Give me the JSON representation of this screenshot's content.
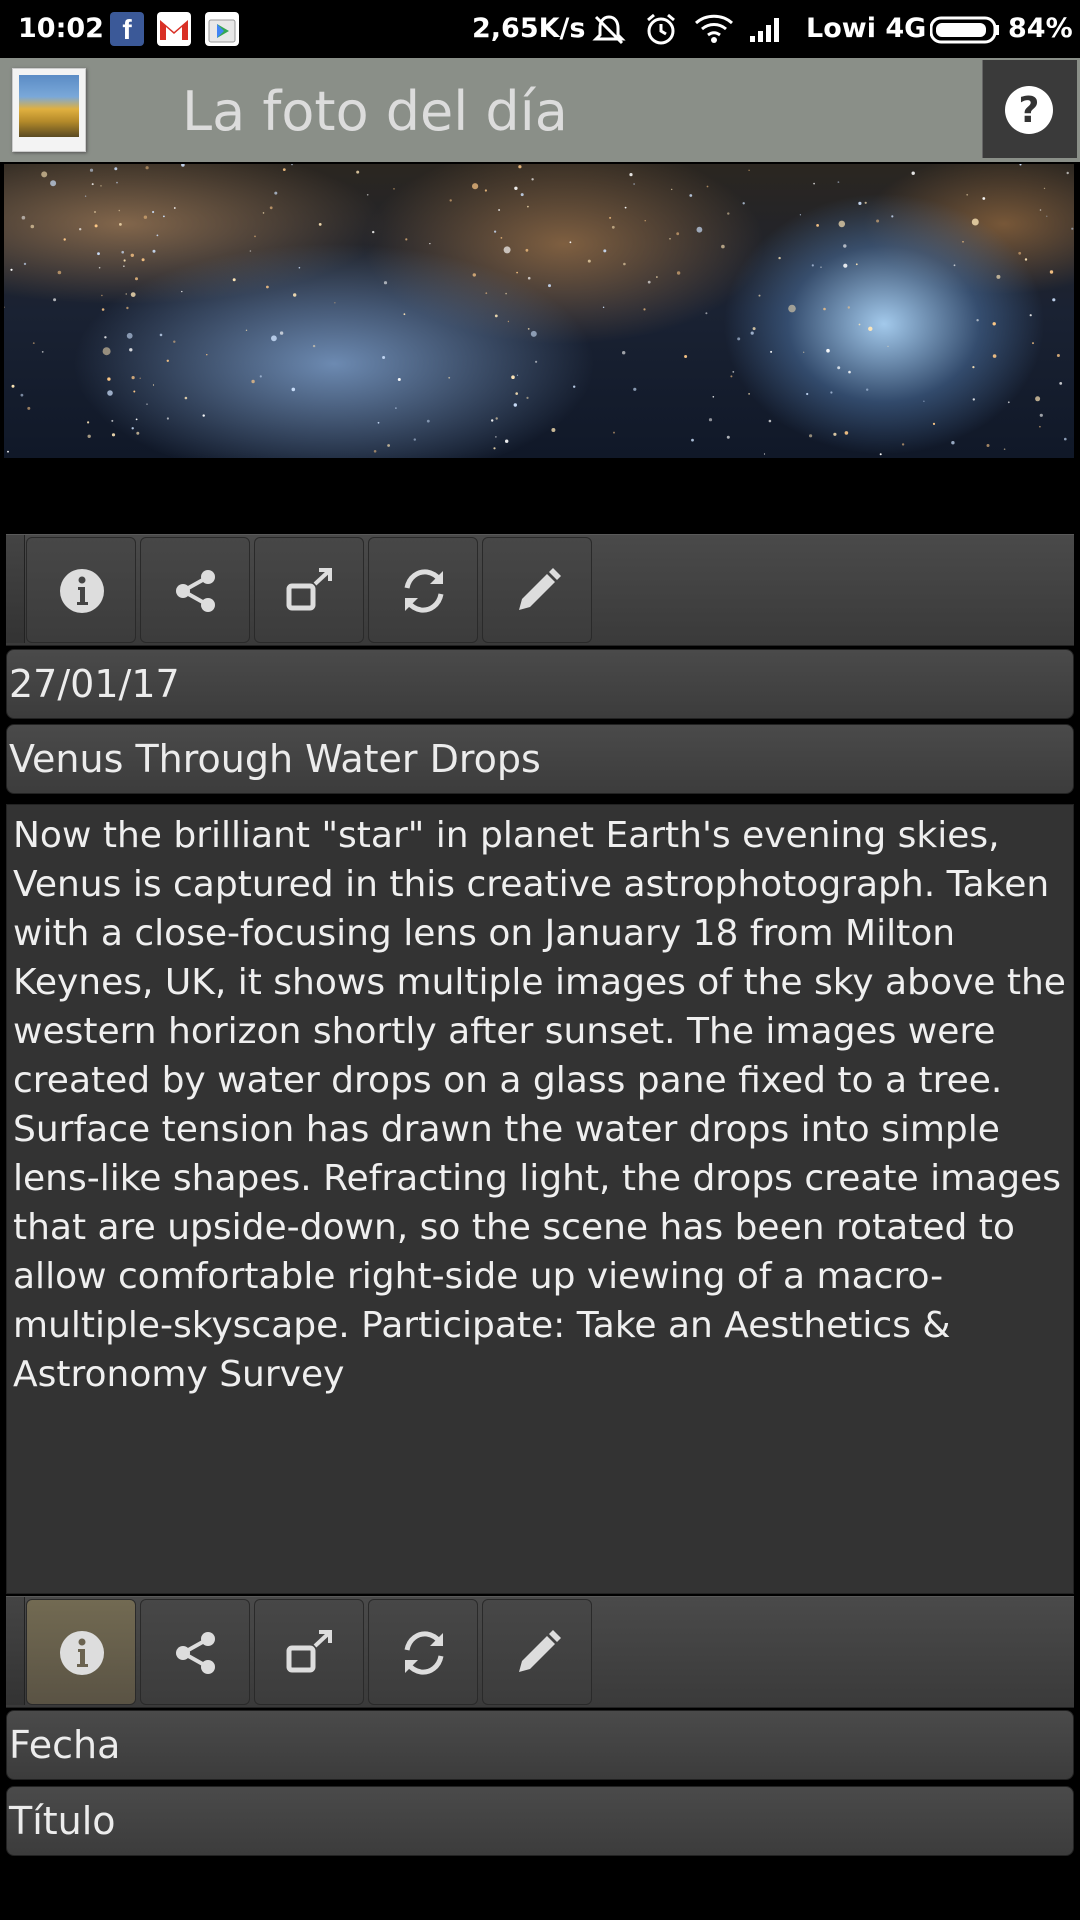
{
  "status_bar": {
    "time": "10:02",
    "speed": "2,65K/s",
    "carrier": "Lowi 4G",
    "battery": "84%",
    "notification_icons": [
      "facebook-icon",
      "gmail-icon",
      "play-store-icon"
    ],
    "system_icons": [
      "mute-icon",
      "alarm-icon",
      "wifi-icon",
      "signal-icon",
      "battery-icon"
    ],
    "facebook_glyph": "f"
  },
  "app_bar": {
    "title": "La foto del día",
    "help_glyph": "?"
  },
  "toolbar_top": {
    "buttons": [
      "info-icon",
      "share-icon",
      "open-external-icon",
      "refresh-icon",
      "edit-icon"
    ]
  },
  "photo": {
    "date": "27/01/17",
    "title": "Venus Through Water Drops",
    "description": "Now the brilliant \"star\" in planet Earth's evening skies, Venus is captured in this creative astrophotograph. Taken with a close-focusing lens on January 18 from Milton Keynes, UK, it shows multiple images of the sky above the western horizon shortly after sunset. The images were created by water drops on a glass pane fixed to a tree. Surface tension has drawn the water drops into simple lens-like shapes. Refracting light, the drops create images that are upside-down, so the scene has been rotated to allow comfortable right-side up viewing of a macro-multiple-skyscape.  Participate: Take an Aesthetics & Astronomy Survey"
  },
  "toolbar_bottom": {
    "active": "info-icon",
    "buttons": [
      "info-icon",
      "share-icon",
      "open-external-icon",
      "refresh-icon",
      "edit-icon"
    ]
  },
  "labels": {
    "date": "Fecha",
    "title": "Título"
  },
  "colors": {
    "app_bar": "#8a8f88",
    "panel": "#3c3c3c",
    "active_button": "#6b6350",
    "text": "#ececec"
  }
}
